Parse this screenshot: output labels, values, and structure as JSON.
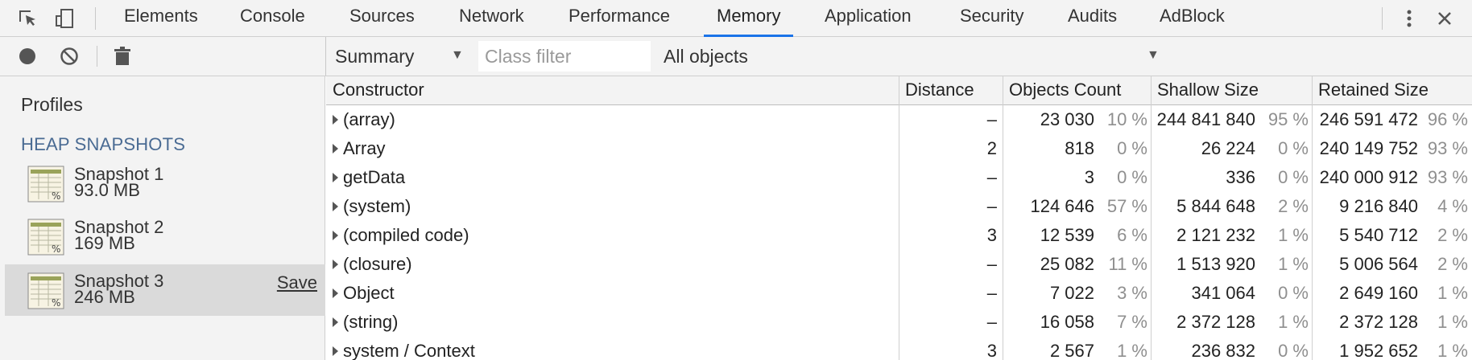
{
  "tabs": [
    {
      "label": "Elements"
    },
    {
      "label": "Console"
    },
    {
      "label": "Sources"
    },
    {
      "label": "Network"
    },
    {
      "label": "Performance"
    },
    {
      "label": "Memory",
      "active": true
    },
    {
      "label": "Application"
    },
    {
      "label": "Security"
    },
    {
      "label": "Audits"
    },
    {
      "label": "AdBlock"
    }
  ],
  "toolbar": {
    "view_select": "Summary",
    "class_filter_placeholder": "Class filter",
    "objects_select": "All objects"
  },
  "sidebar": {
    "profiles_label": "Profiles",
    "heap_snapshots_title": "HEAP SNAPSHOTS",
    "snapshots": [
      {
        "name": "Snapshot 1",
        "size": "93.0 MB"
      },
      {
        "name": "Snapshot 2",
        "size": "169 MB"
      },
      {
        "name": "Snapshot 3",
        "size": "246 MB",
        "selected": true,
        "save_label": "Save"
      }
    ]
  },
  "table": {
    "headers": {
      "constructor": "Constructor",
      "distance": "Distance",
      "objects_count": "Objects Count",
      "shallow_size": "Shallow Size",
      "retained_size": "Retained Size"
    },
    "rows": [
      {
        "constructor": "(array)",
        "distance": "–",
        "count": "23 030",
        "count_pct": "10 %",
        "shallow": "244 841 840",
        "shallow_pct": "95 %",
        "retained": "246 591 472",
        "retained_pct": "96 %"
      },
      {
        "constructor": "Array",
        "distance": "2",
        "count": "818",
        "count_pct": "0 %",
        "shallow": "26 224",
        "shallow_pct": "0 %",
        "retained": "240 149 752",
        "retained_pct": "93 %"
      },
      {
        "constructor": "getData",
        "distance": "–",
        "count": "3",
        "count_pct": "0 %",
        "shallow": "336",
        "shallow_pct": "0 %",
        "retained": "240 000 912",
        "retained_pct": "93 %"
      },
      {
        "constructor": "(system)",
        "distance": "–",
        "count": "124 646",
        "count_pct": "57 %",
        "shallow": "5 844 648",
        "shallow_pct": "2 %",
        "retained": "9 216 840",
        "retained_pct": "4 %"
      },
      {
        "constructor": "(compiled code)",
        "distance": "3",
        "count": "12 539",
        "count_pct": "6 %",
        "shallow": "2 121 232",
        "shallow_pct": "1 %",
        "retained": "5 540 712",
        "retained_pct": "2 %"
      },
      {
        "constructor": "(closure)",
        "distance": "–",
        "count": "25 082",
        "count_pct": "11 %",
        "shallow": "1 513 920",
        "shallow_pct": "1 %",
        "retained": "5 006 564",
        "retained_pct": "2 %"
      },
      {
        "constructor": "Object",
        "distance": "–",
        "count": "7 022",
        "count_pct": "3 %",
        "shallow": "341 064",
        "shallow_pct": "0 %",
        "retained": "2 649 160",
        "retained_pct": "1 %"
      },
      {
        "constructor": "(string)",
        "distance": "–",
        "count": "16 058",
        "count_pct": "7 %",
        "shallow": "2 372 128",
        "shallow_pct": "1 %",
        "retained": "2 372 128",
        "retained_pct": "1 %"
      },
      {
        "constructor": "system / Context",
        "distance": "3",
        "count": "2 567",
        "count_pct": "1 %",
        "shallow": "236 832",
        "shallow_pct": "0 %",
        "retained": "1 952 652",
        "retained_pct": "1 %"
      }
    ]
  },
  "colors": {
    "accent": "#1a73e8",
    "section_title": "#4a6b93",
    "selected_row": "#dadada"
  }
}
